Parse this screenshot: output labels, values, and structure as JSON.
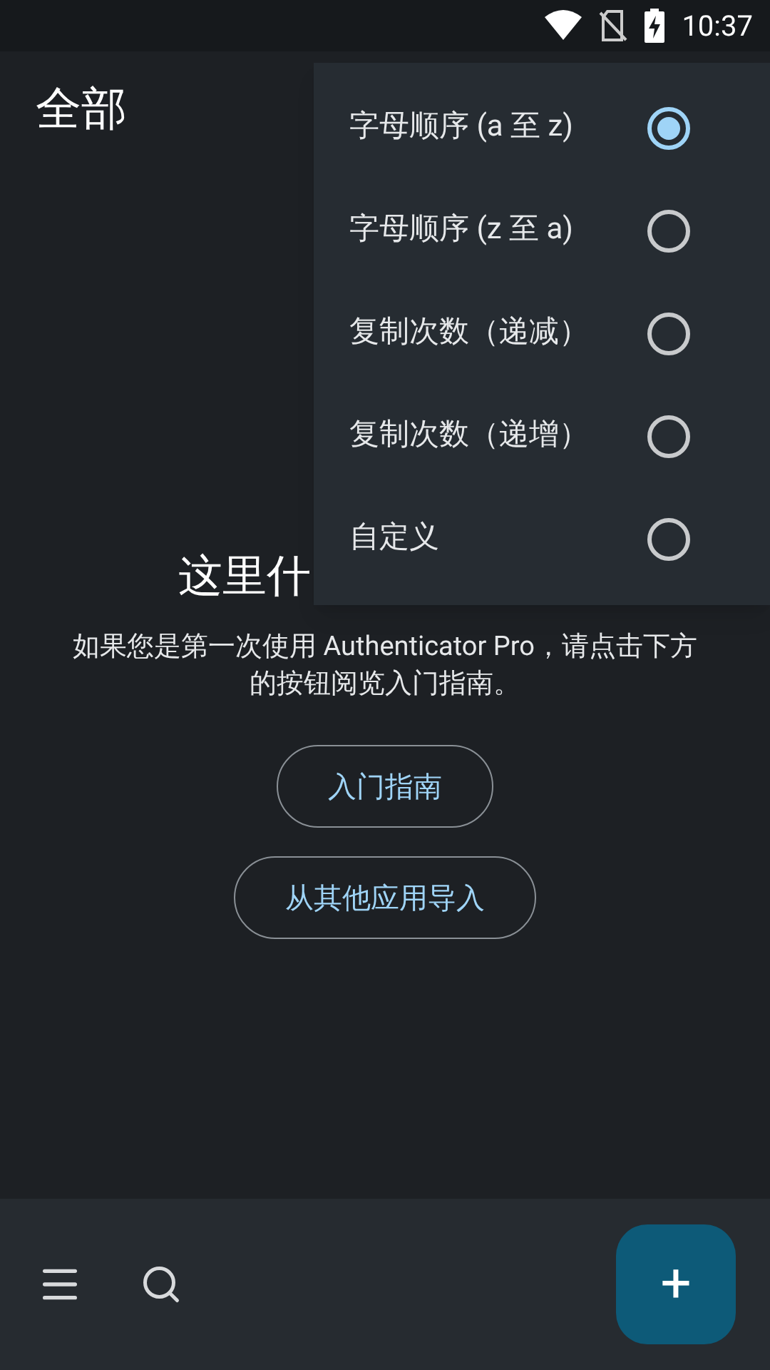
{
  "status_bar": {
    "time": "10:37"
  },
  "header": {
    "title": "全部"
  },
  "empty_state": {
    "heading": "这里什",
    "message": "如果您是第一次使用 Authenticator Pro，请点击下方的按钮阅览入门指南。",
    "buttons": [
      "入门指南",
      "从其他应用导入"
    ]
  },
  "sort_menu": {
    "items": [
      {
        "label": "字母顺序 (a 至 z)",
        "selected": true
      },
      {
        "label": "字母顺序 (z 至 a)",
        "selected": false
      },
      {
        "label": "复制次数（递减）",
        "selected": false
      },
      {
        "label": "复制次数（递增）",
        "selected": false
      },
      {
        "label": "自定义",
        "selected": false
      }
    ]
  },
  "fab": {
    "label": "+"
  }
}
